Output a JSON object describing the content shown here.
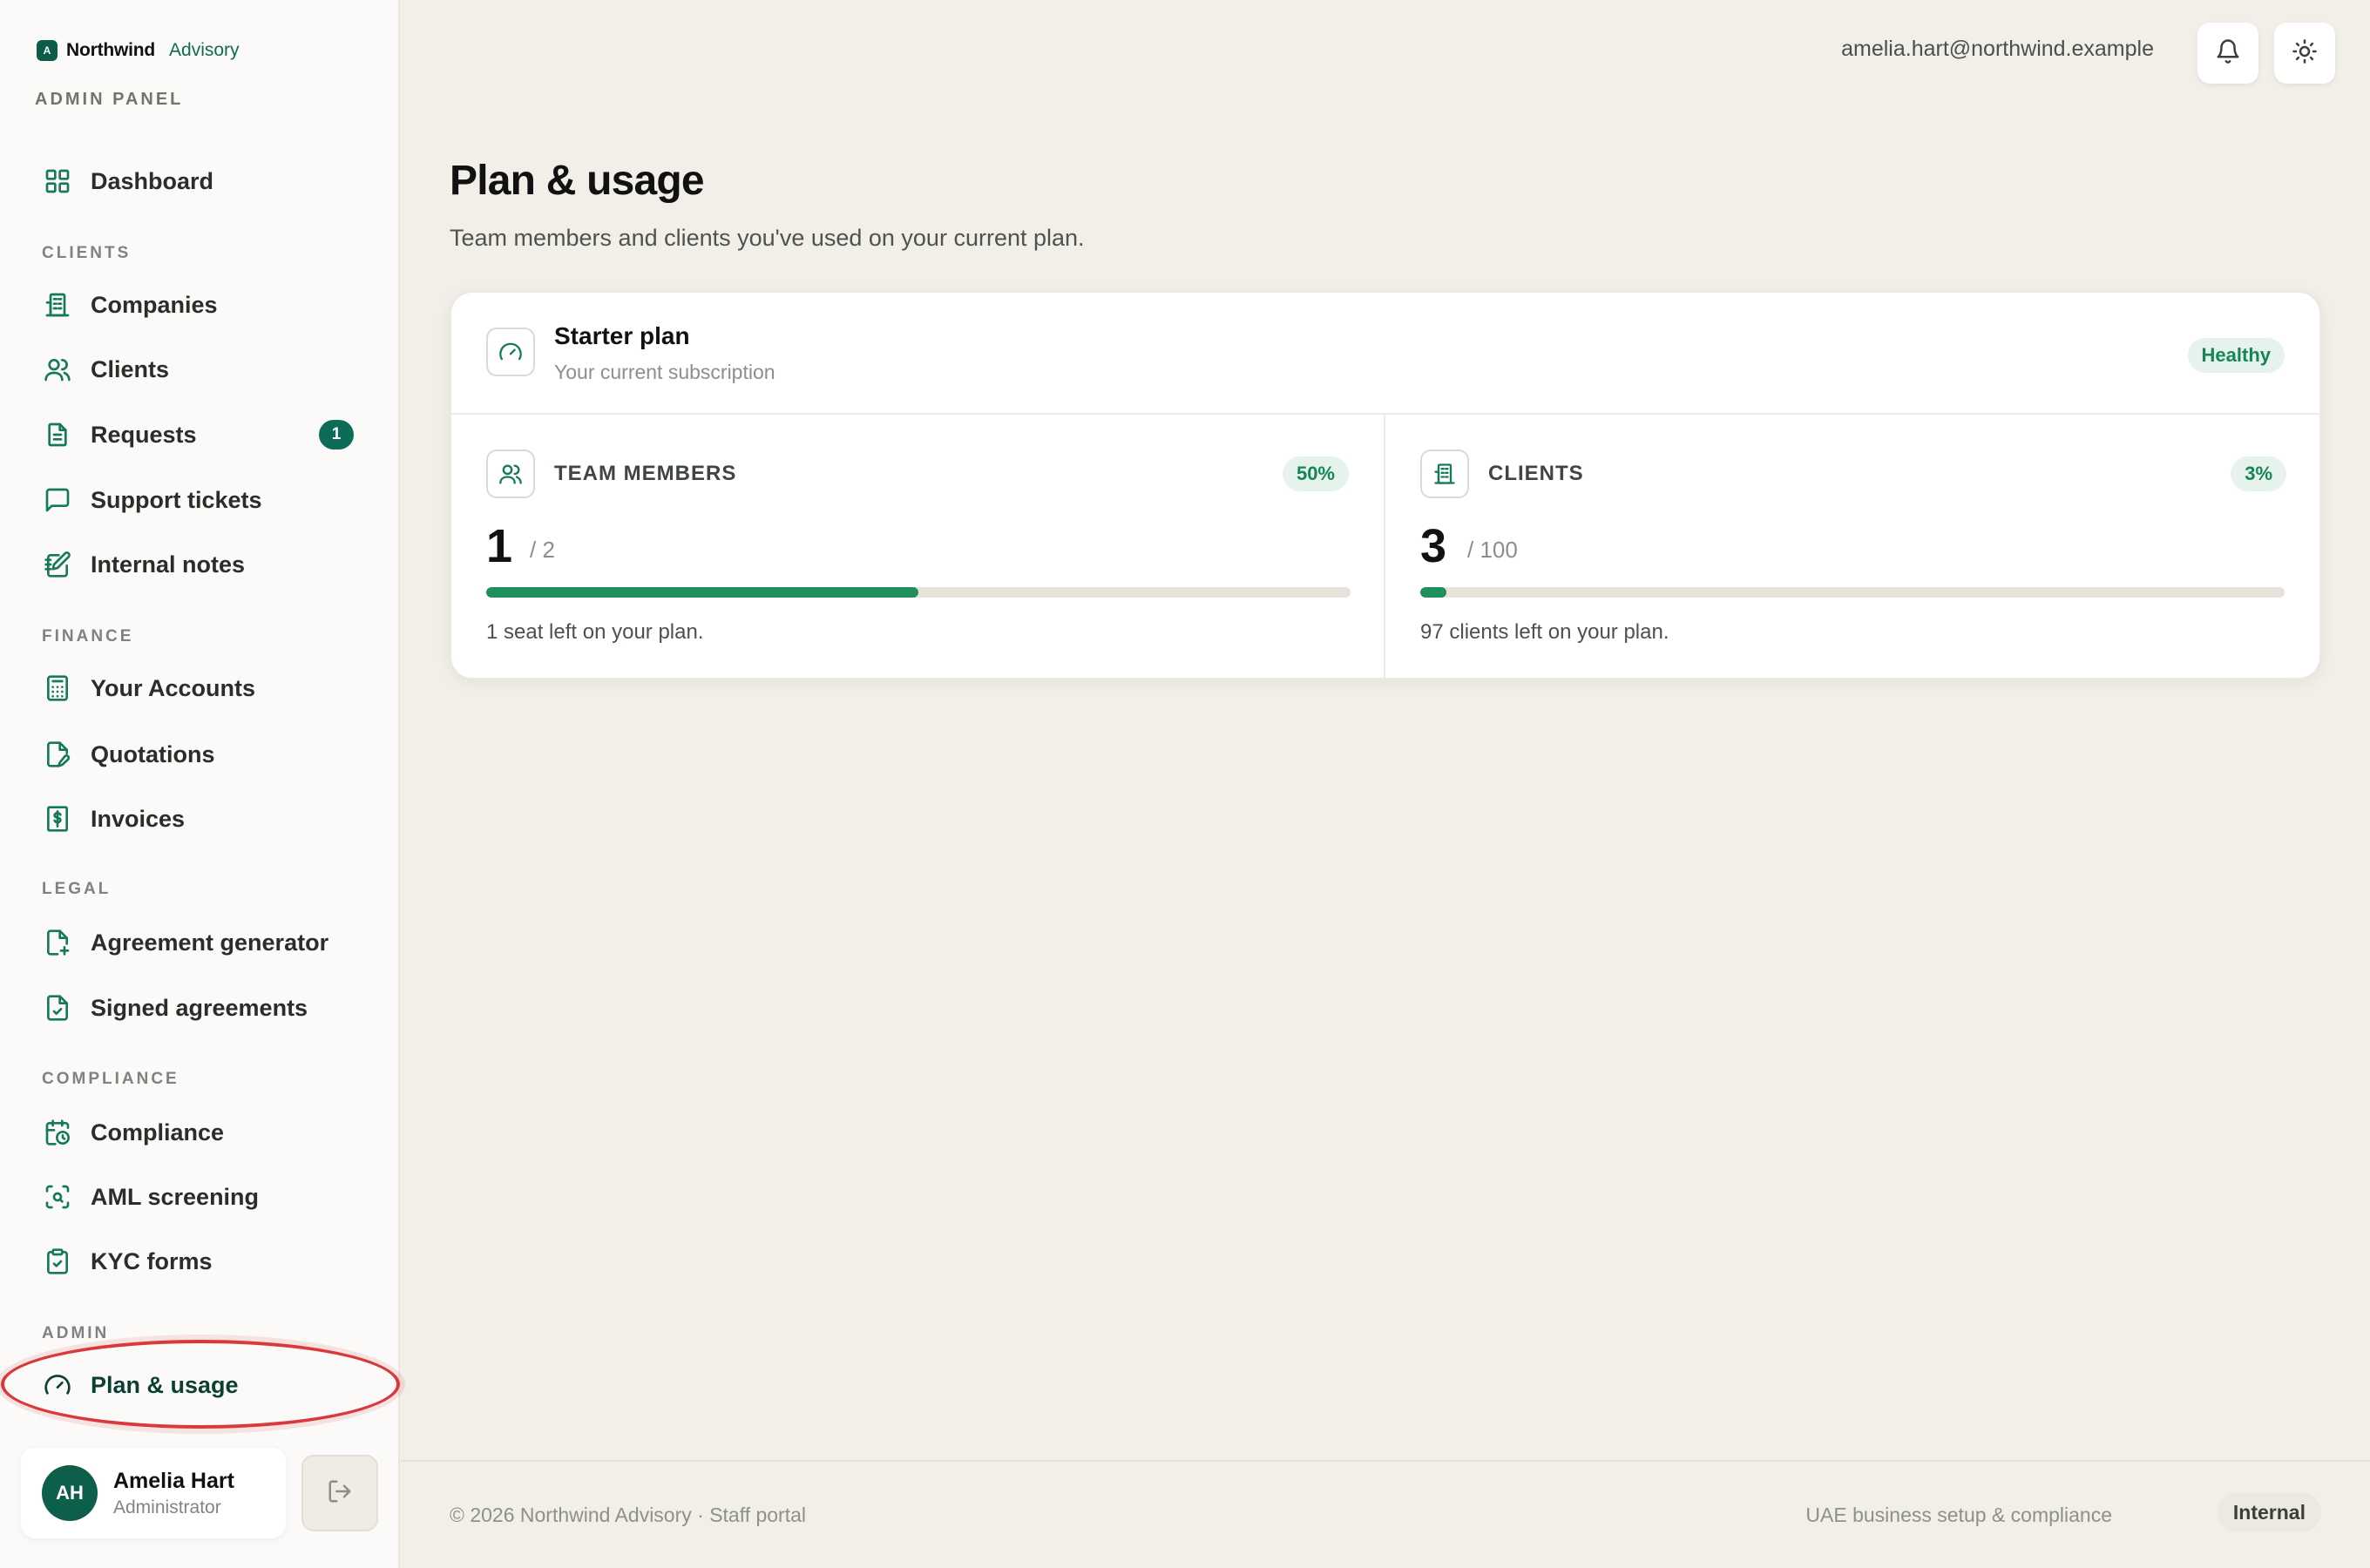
{
  "brand": {
    "mark": "A",
    "name": "Northwind",
    "sub": "Advisory",
    "panel_label": "ADMIN PANEL"
  },
  "sidebar": {
    "dashboard": "Dashboard",
    "sections": {
      "clients": "CLIENTS",
      "finance": "FINANCE",
      "legal": "LEGAL",
      "compliance": "COMPLIANCE",
      "admin": "ADMIN"
    },
    "items": {
      "companies": "Companies",
      "clients": "Clients",
      "requests": "Requests",
      "requests_badge": "1",
      "support_tickets": "Support tickets",
      "internal_notes": "Internal notes",
      "your_accounts": "Your Accounts",
      "quotations": "Quotations",
      "invoices": "Invoices",
      "agreement_generator": "Agreement generator",
      "signed_agreements": "Signed agreements",
      "compliance": "Compliance",
      "aml_screening": "AML screening",
      "kyc_forms": "KYC forms",
      "plan_usage": "Plan & usage"
    },
    "active_item": "plan_usage"
  },
  "user": {
    "initials": "AH",
    "name": "Amelia Hart",
    "role": "Administrator"
  },
  "topbar": {
    "email": "amelia.hart@northwind.example",
    "notification_icon": "bell-icon",
    "theme_icon": "sun-icon"
  },
  "page": {
    "title": "Plan & usage",
    "subtitle": "Team members and clients you've used on your current plan."
  },
  "plan": {
    "name": "Starter plan",
    "description": "Your current subscription",
    "status": "Healthy",
    "team_members": {
      "label": "TEAM MEMBERS",
      "used": "1",
      "limit": "/ 2",
      "percent_label": "50%",
      "fill_fraction": 0.5,
      "note": "1 seat left on your plan."
    },
    "clients": {
      "label": "CLIENTS",
      "used": "3",
      "limit": "/ 100",
      "percent_label": "3%",
      "fill_fraction": 0.03,
      "note": "97 clients left on your plan."
    }
  },
  "footer": {
    "left": "© 2026 Northwind Advisory · Staff portal",
    "right": "UAE business setup & compliance",
    "tag": "Internal"
  },
  "colors": {
    "accent": "#0d5c4a",
    "progress": "#1f8f5f",
    "highlight_ring": "#d9393a"
  }
}
